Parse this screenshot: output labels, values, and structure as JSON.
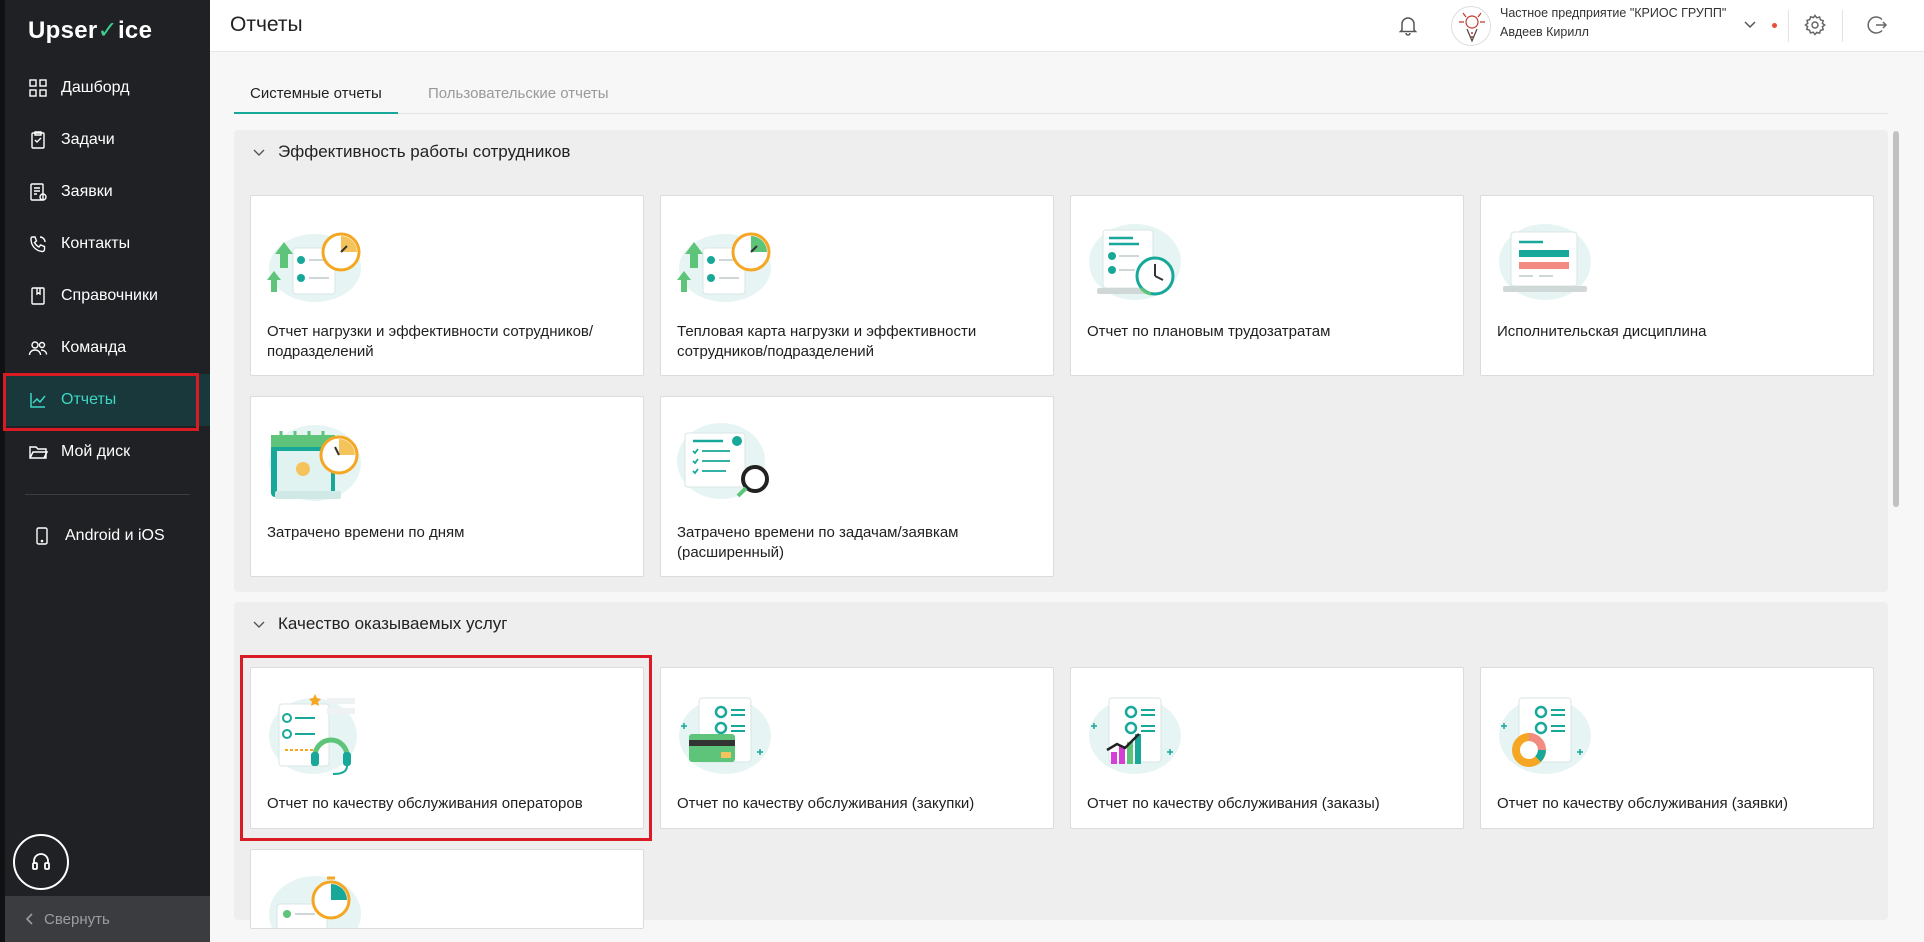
{
  "app": {
    "logo_prefix": "Upser",
    "logo_check": "✓",
    "logo_suffix": "ice"
  },
  "sidebar": {
    "items": [
      {
        "label": "Дашборд",
        "icon": "dashboard-icon"
      },
      {
        "label": "Задачи",
        "icon": "tasks-icon"
      },
      {
        "label": "Заявки",
        "icon": "requests-icon"
      },
      {
        "label": "Контакты",
        "icon": "phone-icon"
      },
      {
        "label": "Справочники",
        "icon": "book-icon"
      },
      {
        "label": "Команда",
        "icon": "team-icon"
      },
      {
        "label": "Отчеты",
        "icon": "chart-icon",
        "active": true
      },
      {
        "label": "Мой диск",
        "icon": "folder-icon"
      }
    ],
    "mobile_item": {
      "label": "Android и iOS",
      "icon": "phone-device-icon"
    },
    "collapse_label": "Свернуть"
  },
  "header": {
    "title": "Отчеты",
    "company": "Частное предприятие \"КРИОС ГРУПП\"",
    "user": "Авдеев Кирилл"
  },
  "tabs": [
    {
      "label": "Системные отчеты",
      "active": true
    },
    {
      "label": "Пользовательские отчеты",
      "active": false
    }
  ],
  "sections": [
    {
      "title": "Эффективность работы сотрудников",
      "cards": [
        {
          "label": "Отчет нагрузки и эффективности сотрудников/ подразделений",
          "icon": "workload-efficiency-icon"
        },
        {
          "label": "Тепловая карта нагрузки и эффективности сотрудников/подразделений",
          "icon": "heatmap-workload-icon"
        },
        {
          "label": "Отчет по плановым трудозатратам",
          "icon": "planned-labor-icon"
        },
        {
          "label": "Исполнительская дисциплина",
          "icon": "discipline-icon"
        },
        {
          "label": "Затрачено времени по дням",
          "icon": "calendar-time-icon"
        },
        {
          "label": "Затрачено времени по задачам/заявкам (расширенный)",
          "icon": "tasks-search-icon"
        }
      ]
    },
    {
      "title": "Качество оказываемых услуг",
      "cards": [
        {
          "label": "Отчет по качеству обслуживания операторов",
          "icon": "operator-headset-icon"
        },
        {
          "label": "Отчет по качеству обслуживания (закупки)",
          "icon": "purchases-card-icon"
        },
        {
          "label": "Отчет по качеству обслуживания (заказы)",
          "icon": "orders-chart-icon"
        },
        {
          "label": "Отчет по качеству обслуживания (заявки)",
          "icon": "requests-donut-icon"
        }
      ]
    }
  ],
  "colors": {
    "accent": "#17a89a",
    "sidebar_bg": "#1f2124",
    "active_text": "#3fd6c6",
    "highlight": "#d91c24"
  }
}
